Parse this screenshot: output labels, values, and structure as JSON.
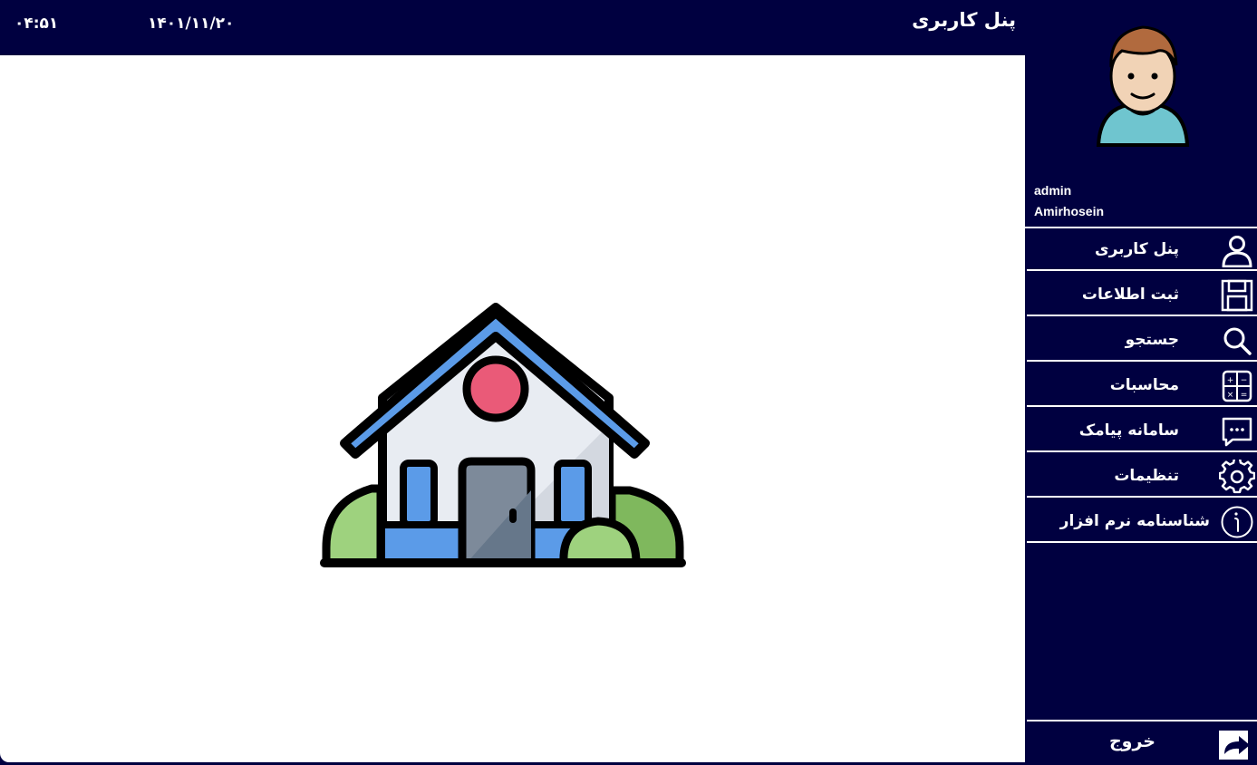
{
  "header": {
    "title": "پنل کاربری",
    "date": "۱۴۰۱/۱۱/۲۰",
    "time": "۰۴:۵۱"
  },
  "user": {
    "role": "admin",
    "name": "Amirhosein"
  },
  "menu": [
    {
      "label": "پنل کاربری",
      "icon": "user-icon"
    },
    {
      "label": "ثبت اطلاعات",
      "icon": "save-icon"
    },
    {
      "label": "جستجو",
      "icon": "search-icon"
    },
    {
      "label": "محاسبات",
      "icon": "calculator-icon"
    },
    {
      "label": "سامانه پیامک",
      "icon": "message-icon"
    },
    {
      "label": "تنظیمات",
      "icon": "gear-icon"
    },
    {
      "label": "شناسنامه نرم افزار",
      "icon": "info-icon"
    }
  ],
  "logout": {
    "label": "خروج",
    "icon": "logout-icon"
  },
  "colors": {
    "navy": "#000040",
    "content_bg": "#ffffff",
    "roof_blue": "#5b9be8",
    "wall": "#e8ecf2",
    "window_red": "#ea5a78",
    "door_gray": "#7d8a9a",
    "bush_green": "#9ed27e"
  }
}
